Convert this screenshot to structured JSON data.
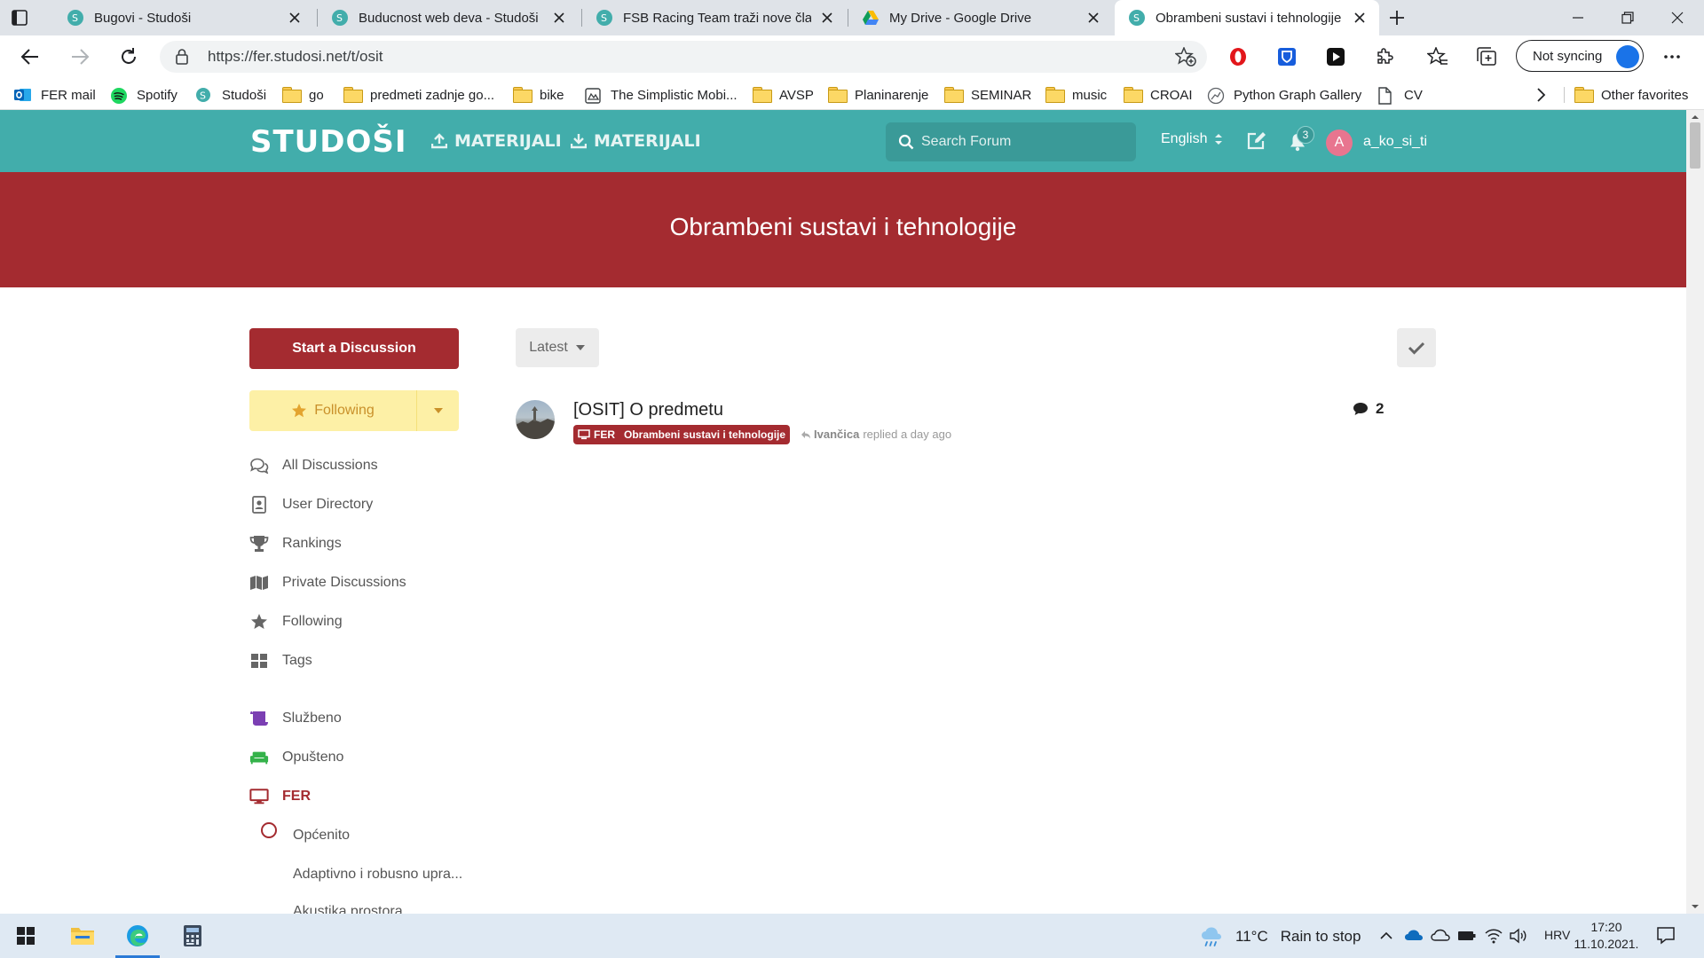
{
  "browser": {
    "tabs": [
      {
        "title": "Bugovi - Studoši",
        "favicon": "studosi"
      },
      {
        "title": "Buducnost web deva - Studoši",
        "favicon": "studosi"
      },
      {
        "title": "FSB Racing Team traži nove članove",
        "favicon": "studosi"
      },
      {
        "title": "My Drive - Google Drive",
        "favicon": "google-drive"
      },
      {
        "title": "Obrambeni sustavi i tehnologije",
        "favicon": "studosi"
      }
    ],
    "active_tab_index": 4,
    "url": "https://fer.studosi.net/t/osit",
    "sync_label": "Not syncing",
    "bookmarks": [
      {
        "label": "FER mail",
        "icon": "outlook-icon"
      },
      {
        "label": "Spotify",
        "icon": "spotify-icon"
      },
      {
        "label": "Studoši",
        "icon": "studosi-icon"
      },
      {
        "label": "go",
        "icon": "folder-icon"
      },
      {
        "label": "predmeti zadnje go...",
        "icon": "folder-icon"
      },
      {
        "label": "bike",
        "icon": "folder-icon"
      },
      {
        "label": "The Simplistic Mobi...",
        "icon": "page-icon"
      },
      {
        "label": "AVSP",
        "icon": "folder-icon"
      },
      {
        "label": "Planinarenje",
        "icon": "folder-icon"
      },
      {
        "label": "SEMINAR",
        "icon": "folder-icon"
      },
      {
        "label": "music",
        "icon": "folder-icon"
      },
      {
        "label": "CROAI",
        "icon": "folder-icon"
      },
      {
        "label": "Python Graph Gallery",
        "icon": "globe-icon"
      },
      {
        "label": "CV",
        "icon": "document-icon"
      }
    ],
    "other_favorites": "Other favorites"
  },
  "site": {
    "logo": "STUDOŠI",
    "upload_label": "MATERIJALI",
    "download_label": "MATERIJALI",
    "search_placeholder": "Search Forum",
    "language": "English",
    "notification_count": "3",
    "avatar_letter": "A",
    "username": "a_ko_si_ti",
    "colors": {
      "header": "#42adab",
      "accent": "#a42b30",
      "following_bg": "#fdf0a6"
    }
  },
  "hero": {
    "title": "Obrambeni sustavi i tehnologije"
  },
  "sidebar": {
    "start_discussion": "Start a Discussion",
    "following_button": "Following",
    "nav": [
      {
        "label": "All Discussions",
        "icon": "comments-icon"
      },
      {
        "label": "User Directory",
        "icon": "address-book-icon"
      },
      {
        "label": "Rankings",
        "icon": "trophy-icon"
      },
      {
        "label": "Private Discussions",
        "icon": "map-icon"
      },
      {
        "label": "Following",
        "icon": "star-icon"
      },
      {
        "label": "Tags",
        "icon": "grid-icon"
      }
    ],
    "tags": [
      {
        "label": "Službeno",
        "icon": "scroll-icon",
        "color": "#7b3fb3"
      },
      {
        "label": "Opušteno",
        "icon": "couch-icon",
        "color": "#34b24a"
      },
      {
        "label": "FER",
        "icon": "monitor-icon",
        "color": "#a42b30"
      }
    ],
    "subtags": [
      "Općenito",
      "Adaptivno i robusno upra...",
      "Akustika prostora"
    ]
  },
  "toolbar": {
    "sort_label": "Latest"
  },
  "discussions": [
    {
      "title": "[OSIT] O predmetu",
      "tag_parent": "FER",
      "tag_child": "Obrambeni sustavi i tehnologije",
      "last_user": "Ivančica",
      "last_action": "replied a day ago",
      "reply_count": "2"
    }
  ],
  "taskbar": {
    "temperature": "11°C",
    "weather": "Rain to stop",
    "language": "HRV",
    "time": "17:20",
    "date": "11.10.2021."
  }
}
